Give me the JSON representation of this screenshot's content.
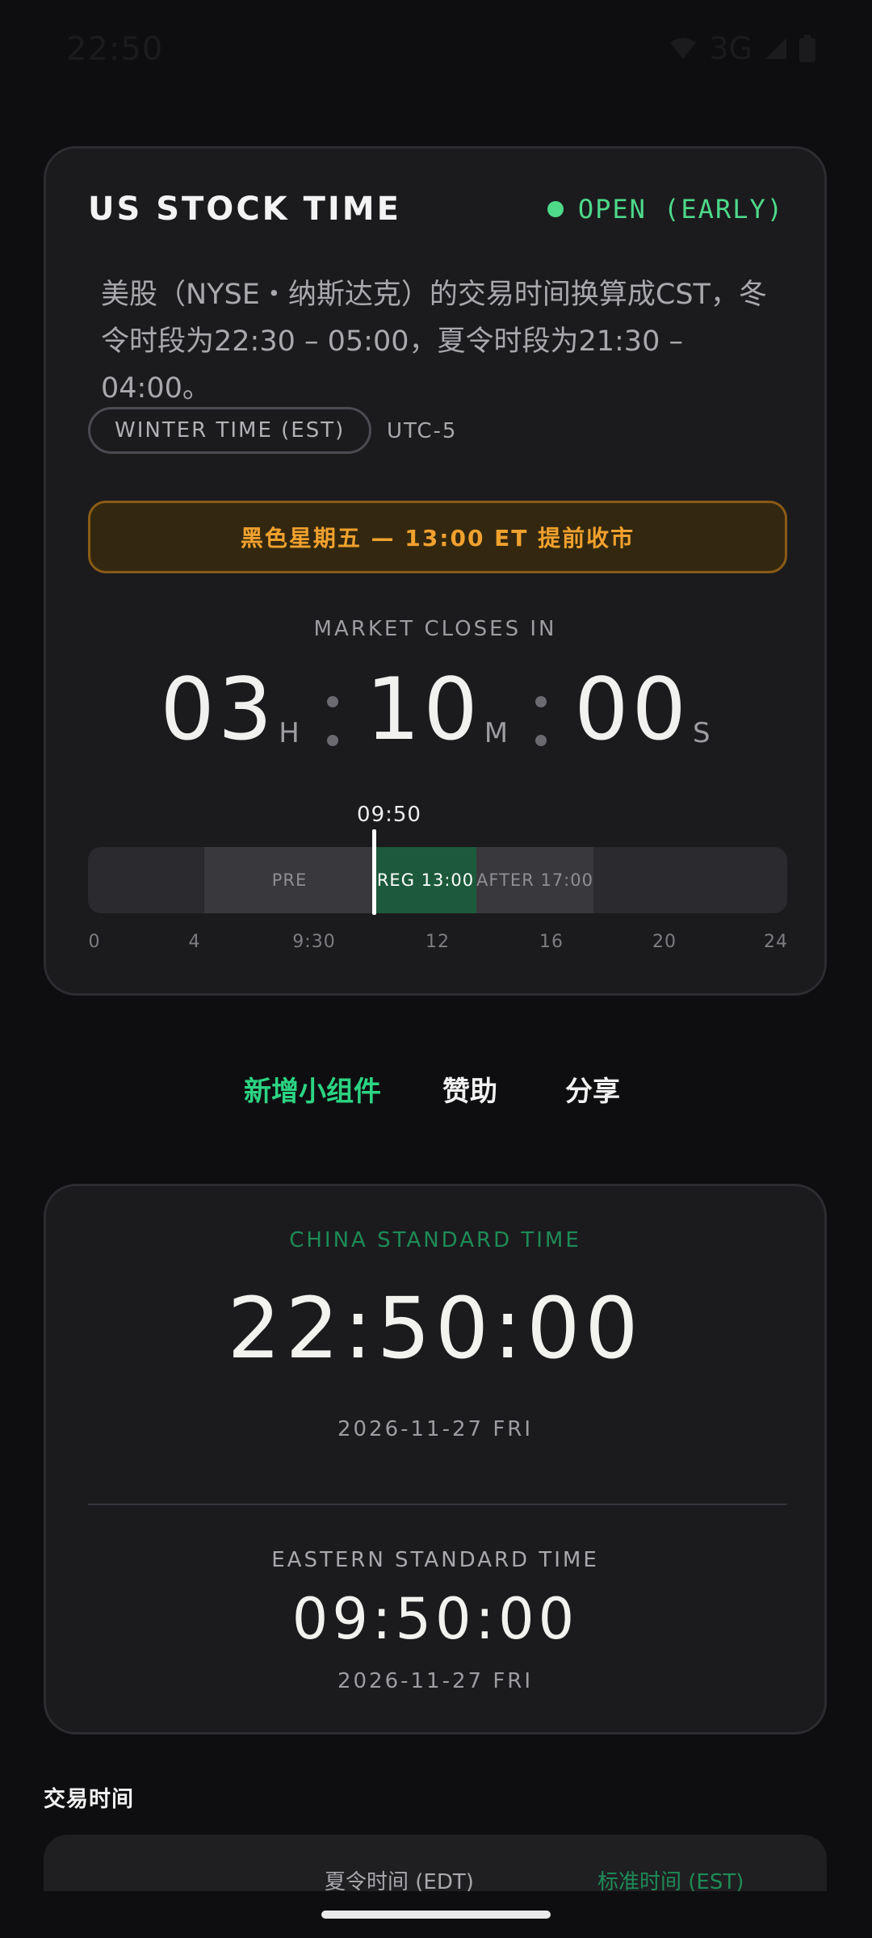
{
  "status_bar": {
    "time": "22:50",
    "network": "3G",
    "icons": [
      "wifi-icon",
      "signal-icon",
      "battery-icon"
    ]
  },
  "market_card": {
    "title": "US STOCK TIME",
    "status": "OPEN (EARLY)",
    "description": "美股（NYSE・纳斯达克）的交易时间换算成CST，冬令时段为22:30 – 05:00，夏令时段为21:30 – 04:00。",
    "season_pill": "WINTER TIME (EST)",
    "utc_offset": "UTC-5",
    "banner": "黑色星期五 — 13:00 ET 提前收市",
    "countdown_label": "MARKET CLOSES IN",
    "countdown": {
      "hours": "03",
      "h_unit": "H",
      "minutes": "10",
      "m_unit": "M",
      "seconds": "00",
      "s_unit": "S"
    },
    "timeline": {
      "now_label": "09:50",
      "segments": {
        "pre": "PRE",
        "reg": "REG 13:00",
        "after": "AFTER 17:00"
      },
      "ticks": [
        "0",
        "4",
        "9:30",
        "12",
        "16",
        "20",
        "24"
      ]
    }
  },
  "actions": {
    "add_widget": "新增小组件",
    "sponsor": "赞助",
    "share": "分享"
  },
  "clock_card": {
    "cst_label": "CHINA STANDARD TIME",
    "cst_time": "22:50:00",
    "cst_date": "2026-11-27 FRI",
    "est_label": "EASTERN STANDARD TIME",
    "est_time": "09:50:00",
    "est_date": "2026-11-27 FRI"
  },
  "trading_hours": {
    "title": "交易时间",
    "col_edt": "夏令时间 (EDT)",
    "col_est": "标准时间 (EST)"
  },
  "colors": {
    "accent": "#2cd483",
    "open": "#4ed98a",
    "warning": "#f0a12e",
    "reg_segment": "#1c5a3b"
  }
}
